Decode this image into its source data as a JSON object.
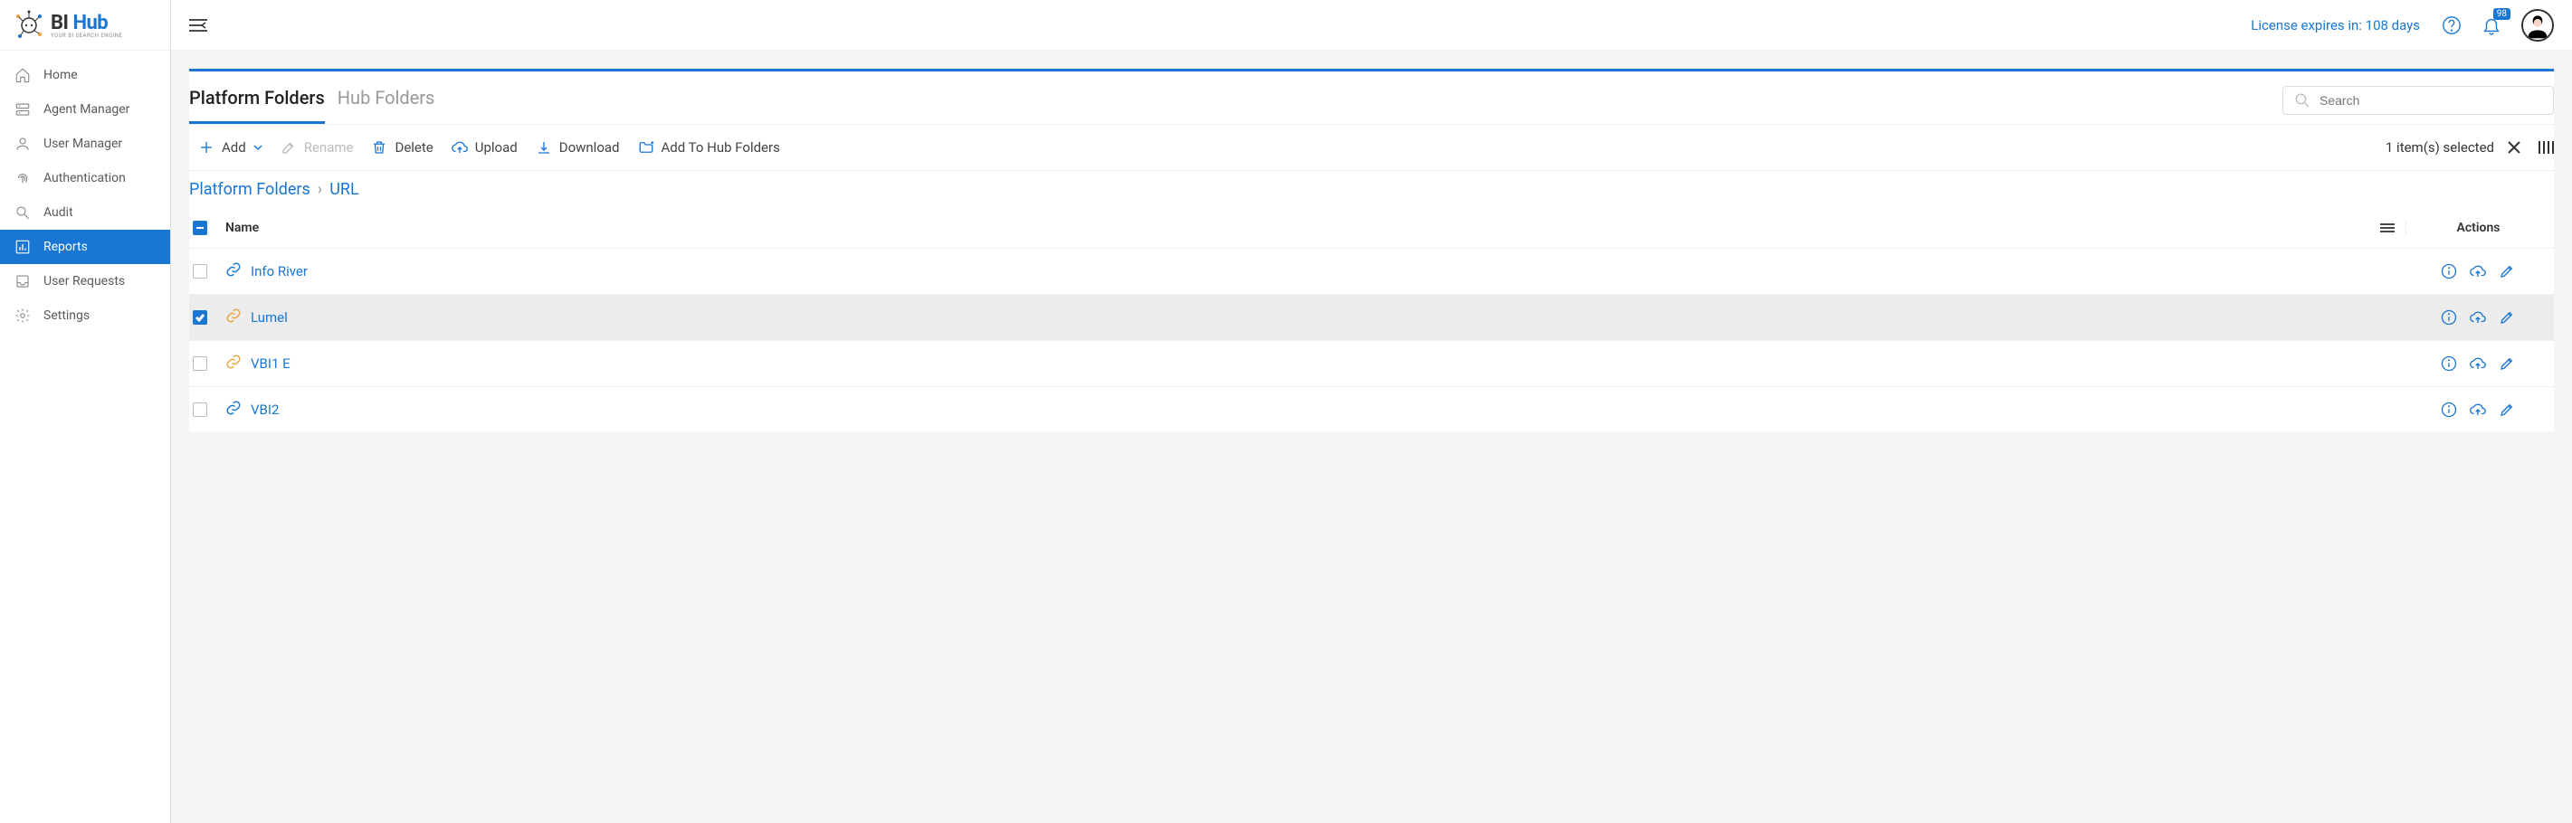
{
  "brand": {
    "name_a": "BI",
    "name_b": "Hub",
    "tagline": "YOUR BI SEARCH ENGINE"
  },
  "header": {
    "license_text": "License expires in: 108 days",
    "notification_count": "98"
  },
  "sidebar": {
    "items": [
      {
        "label": "Home"
      },
      {
        "label": "Agent Manager"
      },
      {
        "label": "User Manager"
      },
      {
        "label": "Authentication"
      },
      {
        "label": "Audit"
      },
      {
        "label": "Reports"
      },
      {
        "label": "User Requests"
      },
      {
        "label": "Settings"
      }
    ]
  },
  "tabs": {
    "platform": "Platform Folders",
    "hub": "Hub Folders"
  },
  "search": {
    "placeholder": "Search"
  },
  "toolbar": {
    "add": "Add",
    "rename": "Rename",
    "delete": "Delete",
    "upload": "Upload",
    "download": "Download",
    "add_hub": "Add To Hub Folders",
    "selection_text": "1 item(s) selected"
  },
  "breadcrumb": {
    "root": "Platform Folders",
    "current": "URL"
  },
  "table": {
    "header_name": "Name",
    "header_actions": "Actions",
    "rows": [
      {
        "name": "Info River",
        "selected": false,
        "orange": false
      },
      {
        "name": "Lumel",
        "selected": true,
        "orange": true
      },
      {
        "name": "VBI1 E",
        "selected": false,
        "orange": true
      },
      {
        "name": "VBI2",
        "selected": false,
        "orange": false
      }
    ]
  }
}
